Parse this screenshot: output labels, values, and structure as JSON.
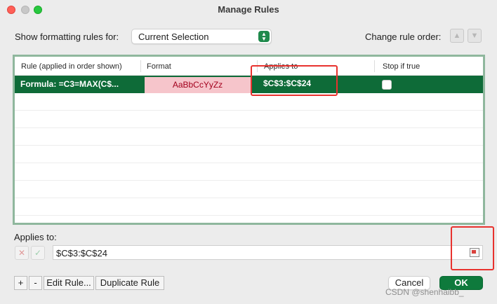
{
  "window": {
    "title": "Manage Rules"
  },
  "top": {
    "show_label": "Show formatting rules for:",
    "show_value": "Current Selection",
    "order_label": "Change rule order:"
  },
  "table": {
    "headers": {
      "rule": "Rule (applied in order shown)",
      "format": "Format",
      "applies": "Applies to",
      "stop": "Stop if true"
    },
    "rows": [
      {
        "rule": "Formula: =C3=MAX(C$...",
        "format_preview": "AaBbCcYyZz",
        "applies": "$C$3:$C$24",
        "stop_if_true": false
      }
    ]
  },
  "applies_to": {
    "label": "Applies to:",
    "value": "$C$3:$C$24"
  },
  "buttons": {
    "add": "+",
    "remove": "-",
    "edit": "Edit Rule...",
    "duplicate": "Duplicate Rule",
    "cancel": "Cancel",
    "ok": "OK"
  },
  "watermark": "CSDN @shenhaibb_",
  "colors": {
    "accent": "#0e7a3c",
    "selected_row": "#0e6b38",
    "format_fill": "#f6c5cb",
    "format_text": "#a3001d",
    "annotation": "#e8322e"
  }
}
